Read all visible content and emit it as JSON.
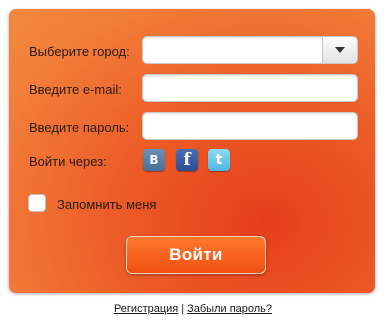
{
  "form": {
    "city_label": "Выберите город:",
    "city_value": "",
    "email_label": "Введите e-mail:",
    "email_value": "",
    "password_label": "Введите пароль:",
    "password_value": "",
    "social_label": "Войти через:",
    "social": [
      {
        "name": "vk-icon",
        "glyph": "B"
      },
      {
        "name": "facebook-icon",
        "glyph": "f"
      },
      {
        "name": "twitter-icon",
        "glyph": "t"
      }
    ],
    "remember_label": "Запомнить меня",
    "remember_checked": false,
    "login_label": "Войти"
  },
  "footer": {
    "register_label": "Регистрация",
    "separator": "|",
    "forgot_label": "Забыли пароль?"
  },
  "colors": {
    "panel_orange": "#f27e3a",
    "panel_red": "#e63e1c",
    "button_orange": "#f04f12",
    "vk_blue": "#4a6f98",
    "facebook_blue": "#2d4e94",
    "twitter_blue": "#4fb7e3"
  }
}
